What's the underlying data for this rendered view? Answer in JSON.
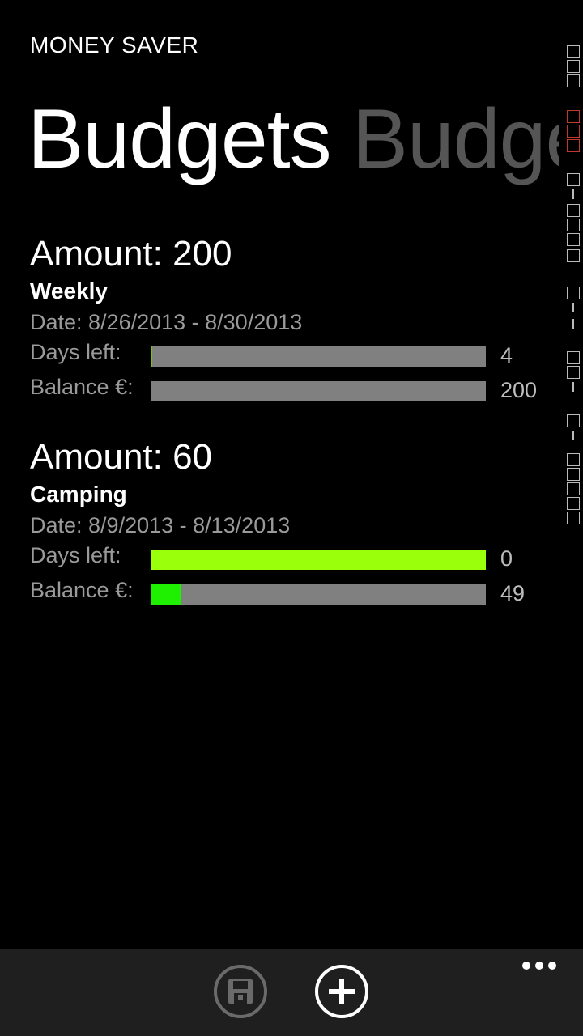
{
  "app": {
    "title": "MONEY SAVER"
  },
  "pivot": {
    "active_label": "Budgets",
    "next_label": "Budge"
  },
  "budgets": [
    {
      "amount_label": "Amount: 200",
      "name": "Weekly",
      "date_label": "Date: 8/26/2013 - 8/30/2013",
      "days_left_label": "Days left:",
      "days_left_value": "4",
      "days_left_fraction": 0.004,
      "days_left_color": "#7ac30a",
      "balance_label": "Balance €:",
      "balance_value": "200",
      "balance_fraction": 0.0,
      "balance_color": "#1fef00"
    },
    {
      "amount_label": "Amount: 60",
      "name": "Camping",
      "date_label": "Date: 8/9/2013 - 8/13/2013",
      "days_left_label": "Days left:",
      "days_left_value": "0",
      "days_left_fraction": 1.0,
      "days_left_color": "#99ff0b",
      "balance_label": "Balance €:",
      "balance_value": "49",
      "balance_fraction": 0.092,
      "balance_color": "#1fef00"
    }
  ],
  "app_bar": {
    "save_icon": "save-icon",
    "add_icon": "add-icon",
    "more_icon": "more-icon"
  }
}
